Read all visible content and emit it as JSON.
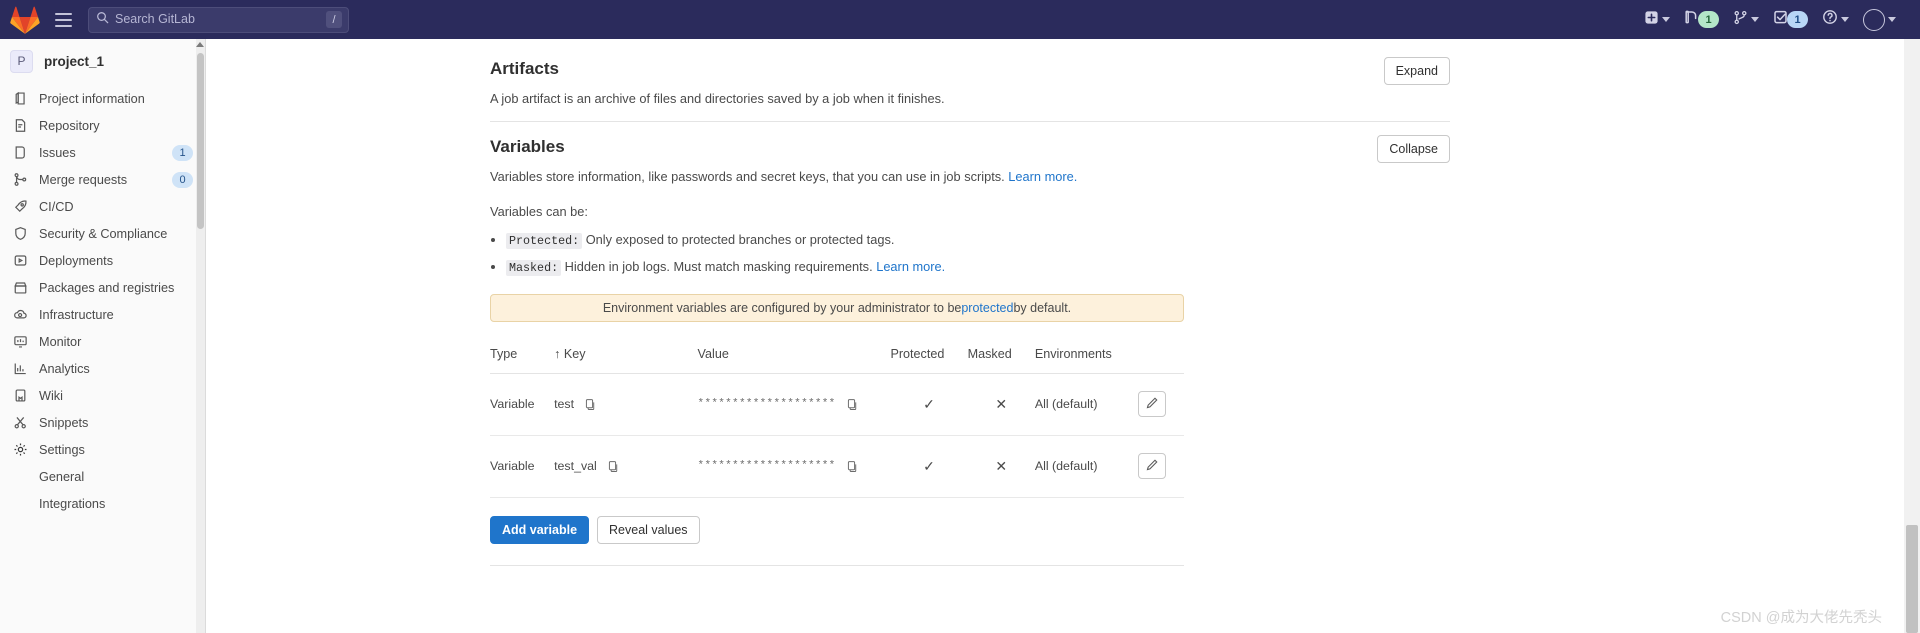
{
  "navbar": {
    "logo_icon": "gitlab-logo-icon",
    "menu_icon": "hamburger-menu-icon",
    "search": {
      "placeholder": "Search GitLab",
      "value": "",
      "icon": "search-icon",
      "shortcut_badge": "/"
    },
    "right_items": [
      {
        "name": "create-new-menu",
        "icon": "plus-square-icon",
        "badge": "",
        "caret": true
      },
      {
        "name": "merge-requests-menu",
        "icon": "merge-request-icon",
        "badge": "1",
        "badge_color": "#b3e6c8",
        "caret": false
      },
      {
        "name": "issues-menu",
        "icon": "branch-icon",
        "badge": "",
        "caret": true
      },
      {
        "name": "todos-menu",
        "icon": "todo-checkbox-icon",
        "badge": "1",
        "badge_color": "#b8d6f6",
        "caret": false
      },
      {
        "name": "help-menu",
        "icon": "question-circle-icon",
        "badge": "",
        "caret": true
      },
      {
        "name": "user-menu",
        "icon": "avatar-icon",
        "badge": "",
        "caret": true
      }
    ]
  },
  "sidebar": {
    "project": {
      "initial": "P",
      "name": "project_1"
    },
    "items": [
      {
        "label": "Project information",
        "icon": "project-info-icon",
        "badge": ""
      },
      {
        "label": "Repository",
        "icon": "repository-icon",
        "badge": ""
      },
      {
        "label": "Issues",
        "icon": "issues-icon",
        "badge": "1"
      },
      {
        "label": "Merge requests",
        "icon": "merge-requests-icon",
        "badge": "0"
      },
      {
        "label": "CI/CD",
        "icon": "rocket-icon",
        "badge": ""
      },
      {
        "label": "Security & Compliance",
        "icon": "shield-icon",
        "badge": ""
      },
      {
        "label": "Deployments",
        "icon": "deployments-icon",
        "badge": ""
      },
      {
        "label": "Packages and registries",
        "icon": "package-icon",
        "badge": ""
      },
      {
        "label": "Infrastructure",
        "icon": "infrastructure-icon",
        "badge": ""
      },
      {
        "label": "Monitor",
        "icon": "monitor-icon",
        "badge": ""
      },
      {
        "label": "Analytics",
        "icon": "analytics-icon",
        "badge": ""
      },
      {
        "label": "Wiki",
        "icon": "wiki-icon",
        "badge": ""
      },
      {
        "label": "Snippets",
        "icon": "snippets-icon",
        "badge": ""
      },
      {
        "label": "Settings",
        "icon": "gear-icon",
        "badge": ""
      }
    ],
    "sub_items": [
      {
        "label": "General"
      },
      {
        "label": "Integrations"
      }
    ]
  },
  "main": {
    "artifacts": {
      "title": "Artifacts",
      "description": "A job artifact is an archive of files and directories saved by a job when it finishes.",
      "toggle_label": "Expand"
    },
    "variables": {
      "title": "Variables",
      "description_text": "Variables store information, like passwords and secret keys, that you can use in job scripts.",
      "description_link": "Learn more.",
      "toggle_label": "Collapse",
      "lead": "Variables can be:",
      "types": [
        {
          "keyword": "Protected:",
          "text": " Only exposed to protected branches or protected tags.",
          "link": ""
        },
        {
          "keyword": "Masked:",
          "text": " Hidden in job logs. Must match masking requirements. ",
          "link": "Learn more."
        }
      ],
      "alert": {
        "text_before": "Environment variables are configured by your administrator to be ",
        "link": "protected",
        "text_after": " by default."
      },
      "table": {
        "columns": [
          "Type",
          "↑ Key",
          "Value",
          "Protected",
          "Masked",
          "Environments"
        ],
        "rows": [
          {
            "type": "Variable",
            "key": "test",
            "value": "********************",
            "protected": "✓",
            "masked": "✕",
            "environments": "All (default)",
            "edit_icon": "pencil-icon"
          },
          {
            "type": "Variable",
            "key": "test_val",
            "value": "********************",
            "protected": "✓",
            "masked": "✕",
            "environments": "All (default)",
            "edit_icon": "pencil-icon"
          }
        ]
      },
      "actions": {
        "add_label": "Add variable",
        "reveal_label": "Reveal values"
      }
    }
  },
  "watermark": "CSDN @成为大佬先秃头",
  "colors": {
    "navbar_bg": "#2b2b5c",
    "primary": "#1f75cb",
    "link": "#1f75cb",
    "alert_bg": "#fdf1dc",
    "alert_border": "#e9d3a6",
    "badge_green": "#b3e6c8",
    "badge_blue": "#b8d6f6"
  }
}
